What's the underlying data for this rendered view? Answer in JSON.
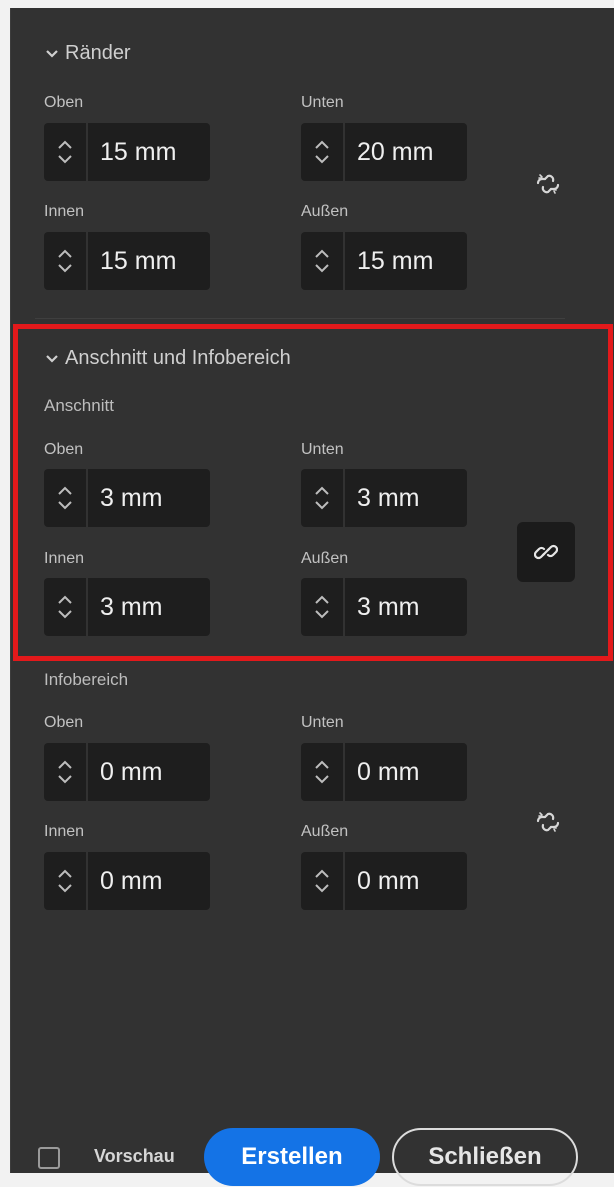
{
  "sections": {
    "margins": {
      "title": "Ränder",
      "top": {
        "label": "Oben",
        "value": "15 mm"
      },
      "bottom": {
        "label": "Unten",
        "value": "20 mm"
      },
      "inside": {
        "label": "Innen",
        "value": "15 mm"
      },
      "outside": {
        "label": "Außen",
        "value": "15 mm"
      },
      "linked": false
    },
    "bleed_slug": {
      "title": "Anschnitt und Infobereich",
      "bleed": {
        "label": "Anschnitt",
        "top": {
          "label": "Oben",
          "value": "3 mm"
        },
        "bottom": {
          "label": "Unten",
          "value": "3 mm"
        },
        "inside": {
          "label": "Innen",
          "value": "3 mm"
        },
        "outside": {
          "label": "Außen",
          "value": "3 mm"
        },
        "linked": true
      },
      "slug": {
        "label": "Infobereich",
        "top": {
          "label": "Oben",
          "value": "0 mm"
        },
        "bottom": {
          "label": "Unten",
          "value": "0 mm"
        },
        "inside": {
          "label": "Innen",
          "value": "0 mm"
        },
        "outside": {
          "label": "Außen",
          "value": "0 mm"
        },
        "linked": false
      }
    }
  },
  "footer": {
    "preview_label": "Vorschau",
    "preview_checked": false,
    "create_label": "Erstellen",
    "close_label": "Schließen"
  },
  "colors": {
    "panel_bg": "#323232",
    "field_bg": "#1e1e1e",
    "accent_blue": "#1473e6",
    "highlight_red": "#e3191b"
  },
  "icons": [
    "chevron-down-icon",
    "stepper-up-icon",
    "stepper-down-icon",
    "unlinked-chain-icon",
    "linked-chain-icon",
    "checkbox-icon"
  ]
}
